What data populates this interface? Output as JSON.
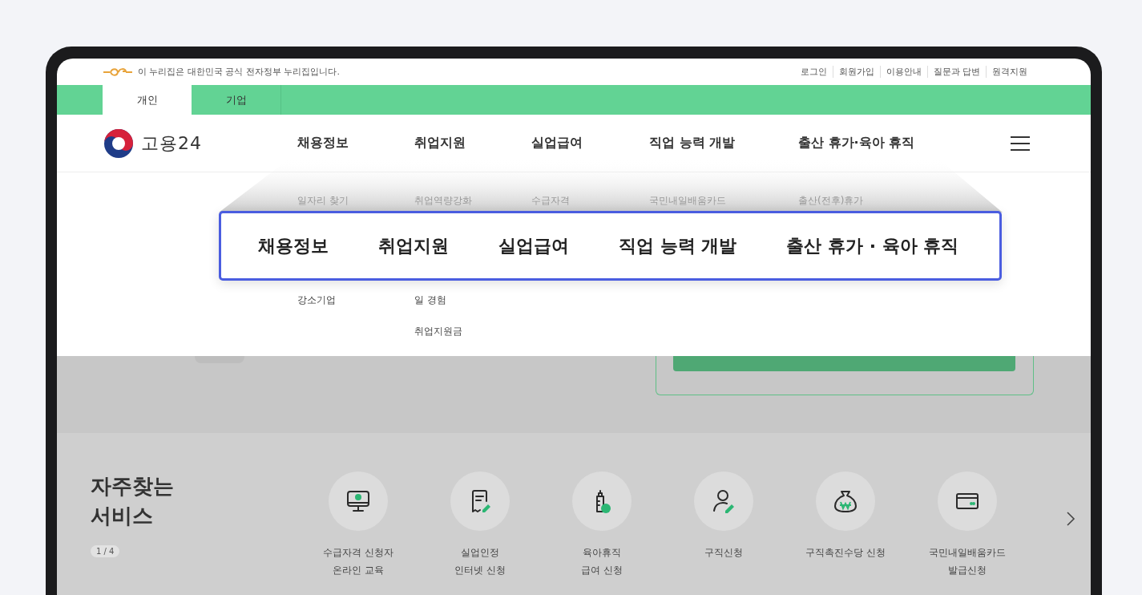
{
  "gov_banner": {
    "text": "이 누리집은 대한민국 공식 전자정부 누리집입니다."
  },
  "utility_links": [
    "로그인",
    "회원가입",
    "이용안내",
    "질문과 답변",
    "원격지원"
  ],
  "user_tabs": [
    {
      "label": "개인",
      "selected": true
    },
    {
      "label": "기업",
      "selected": false
    }
  ],
  "logo": {
    "text": "고용24"
  },
  "main_menu": [
    "채용정보",
    "취업지원",
    "실업급여",
    "직업 능력 개발",
    "출산 휴가·육아 휴직"
  ],
  "dropdown_columns": [
    {
      "items_above": [
        "일자리 찾기"
      ],
      "items_below": [
        "강소기업"
      ]
    },
    {
      "items_above": [
        "취업역량강화"
      ],
      "items_below": [
        "일 경험",
        "취업지원금"
      ]
    },
    {
      "items_above": [
        "수급자격"
      ]
    },
    {
      "items_above": [
        "국민내일배움카드"
      ]
    },
    {
      "items_above": [
        "출산(전후)휴가"
      ]
    }
  ],
  "callout_menu": [
    "채용정보",
    "취업지원",
    "실업급여",
    "직업 능력 개발",
    "출산 휴가 · 육아 휴직"
  ],
  "services": {
    "title": "자주찾는\n서비스",
    "page": "1 / 4",
    "items": [
      {
        "kind": "monitor",
        "label": "수급자격 신청자\n온라인 교육"
      },
      {
        "kind": "document",
        "label": "실업인정\n인터넷 신청"
      },
      {
        "kind": "bottle",
        "label": "육아휴직\n급여 신청"
      },
      {
        "kind": "person",
        "label": "구직신청"
      },
      {
        "kind": "moneybag",
        "label": "구직촉진수당 신청"
      },
      {
        "kind": "card",
        "label": "국민내일배움카드\n발급신청"
      }
    ]
  }
}
